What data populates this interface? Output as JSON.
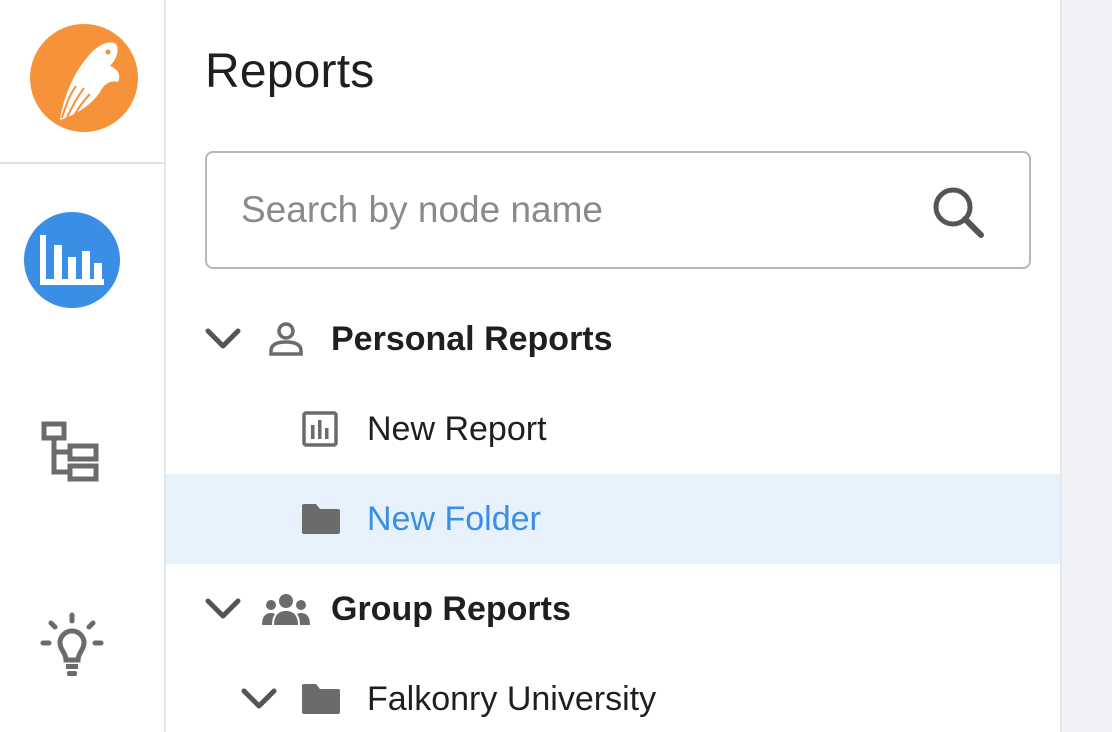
{
  "rail": {
    "items": [
      {
        "name": "reports",
        "icon": "bar-chart-icon",
        "active": true
      },
      {
        "name": "hierarchy",
        "icon": "hierarchy-icon",
        "active": false
      },
      {
        "name": "insights",
        "icon": "lightbulb-icon",
        "active": false
      }
    ],
    "logo_icon": "falcon-logo-icon",
    "colors": {
      "logo": "#f5923a",
      "active": "#3a8ee6"
    }
  },
  "panel": {
    "title": "Reports",
    "search": {
      "placeholder": "Search by node name",
      "value": ""
    }
  },
  "tree": {
    "personal": {
      "label": "Personal Reports",
      "icon": "user-icon",
      "expanded": true
    },
    "new_report": {
      "label": "New Report",
      "icon": "report-icon"
    },
    "new_folder": {
      "label": "New Folder",
      "icon": "folder-icon",
      "selected": true
    },
    "group": {
      "label": "Group Reports",
      "icon": "users-icon",
      "expanded": true
    },
    "falkonry": {
      "label": "Falkonry University",
      "icon": "folder-icon",
      "expanded": true
    }
  },
  "colors": {
    "selected_bg": "#e6f1fb",
    "link": "#3a8ee6"
  }
}
